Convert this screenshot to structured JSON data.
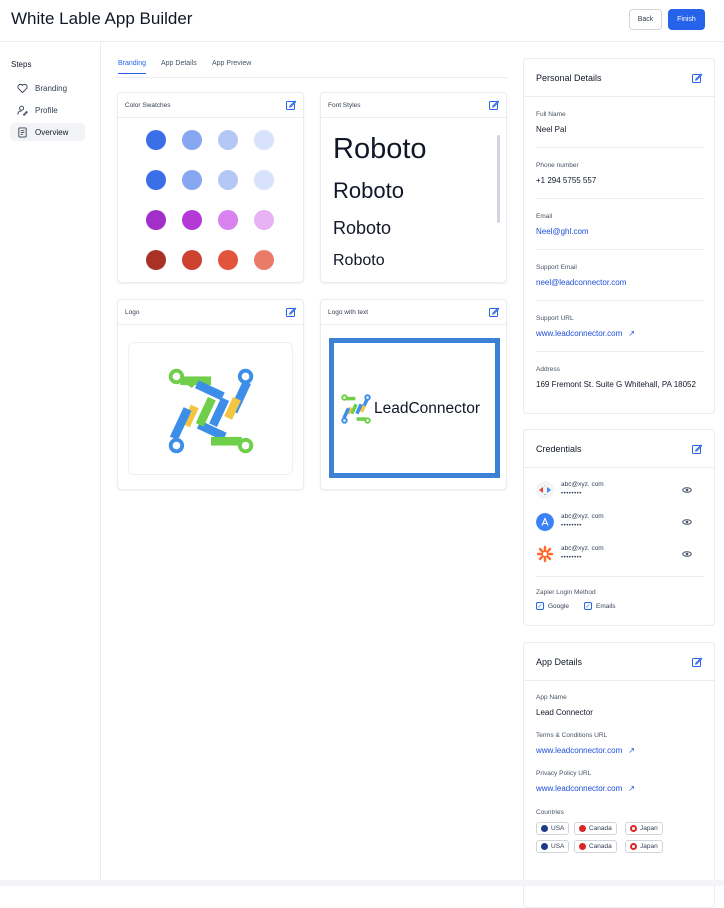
{
  "header": {
    "title": "White Lable App Builder",
    "back_label": "Back",
    "finish_label": "Finish"
  },
  "sidebar": {
    "title": "Steps",
    "items": [
      {
        "label": "Branding",
        "icon": "heart-icon"
      },
      {
        "label": "Profile",
        "icon": "user-edit-icon"
      },
      {
        "label": "Overview",
        "icon": "document-icon"
      }
    ]
  },
  "tabs": [
    {
      "label": "Branding"
    },
    {
      "label": "App Details"
    },
    {
      "label": "App Preview"
    }
  ],
  "branding": {
    "color_swatches_title": "Color Swatches",
    "font_styles_title": "Font Styles",
    "font_samples": [
      "Roboto",
      "Roboto",
      "Roboto",
      "Roboto"
    ],
    "logo_title": "Logo",
    "logo_text_title": "Logo with text",
    "logo_wordmark": "LeadConnector",
    "swatch_rows": [
      [
        "#3b6fe8",
        "#86a6f2",
        "#b3c8f5",
        "#d8e2fa"
      ],
      [
        "#3b6fe8",
        "#86a6f2",
        "#b3c8f5",
        "#d8e2fa"
      ],
      [
        "#a22fc9",
        "#b43ad6",
        "#d882ee",
        "#e7b3f4"
      ],
      [
        "#a93226",
        "#cc4130",
        "#e2553d",
        "#ea7b6a"
      ]
    ]
  },
  "personal": {
    "title": "Personal Details",
    "full_name_label": "Full Name",
    "full_name": "Neel Pal",
    "phone_label": "Phone number",
    "phone": "+1 294 5755 557",
    "email_label": "Email",
    "email": "Neel@ghl.com",
    "support_email_label": "Support Email",
    "support_email": "neel@leadconnector.com",
    "support_url_label": "Support URL",
    "support_url": "www.leadconnector.com",
    "address_label": "Address",
    "address": "169 Fremont St. Suite G Whitehall, PA 18052"
  },
  "credentials": {
    "title": "Credentials",
    "items": [
      {
        "email": "abc@xyz. com",
        "password": "••••••••"
      },
      {
        "email": "abc@xyz. com",
        "password": "••••••••"
      },
      {
        "email": "abc@xyz. com",
        "password": "••••••••"
      }
    ],
    "zapier_label": "Zapier Login Method",
    "google_label": "Google",
    "emails_label": "Emails"
  },
  "app_details": {
    "title": "App Details",
    "app_name_label": "App Name",
    "app_name": "Lead Connector",
    "terms_label": "Terms & Conditions URL",
    "terms_url": "www.leadconnector.com",
    "privacy_label": "Privacy Policy URL",
    "privacy_url": "www.leadconnector.com",
    "countries_label": "Countries",
    "countries": [
      "USA",
      "Canada",
      "Japan",
      "USA",
      "Canada",
      "Japan"
    ]
  },
  "colors": {
    "accent": "#2563eb",
    "link": "#1d4ed8"
  }
}
